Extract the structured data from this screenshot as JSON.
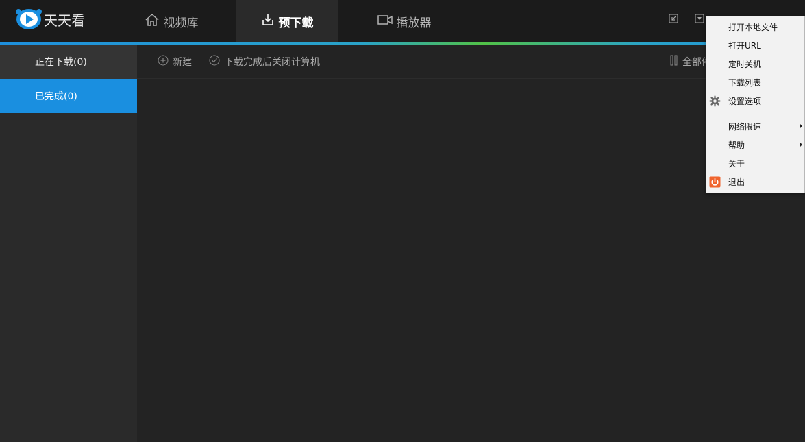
{
  "app": {
    "name": "天天看",
    "brand_color": "#1a8fe0"
  },
  "nav": {
    "tabs": [
      {
        "label": "视频库",
        "icon": "home-icon",
        "active": false
      },
      {
        "label": "预下载",
        "icon": "download-icon",
        "active": true
      },
      {
        "label": "播放器",
        "icon": "video-camera-icon",
        "active": false
      }
    ]
  },
  "window_controls": {
    "mini_icon": "mini-mode-icon",
    "menu_icon": "dropdown-menu-icon"
  },
  "sidebar": {
    "items": [
      {
        "label": "正在下载(0)",
        "active": false
      },
      {
        "label": "已完成(0)",
        "active": true
      }
    ]
  },
  "toolbar": {
    "new_label": "新建",
    "shutdown_label": "下载完成后关闭计算机",
    "pause_all_label": "全部停"
  },
  "context_menu": {
    "items": [
      {
        "label": "打开本地文件"
      },
      {
        "label": "打开URL"
      },
      {
        "label": "定时关机"
      },
      {
        "label": "下载列表"
      },
      {
        "label": "设置选项",
        "icon": "gear-icon"
      },
      {
        "label": "网络限速",
        "submenu": true
      },
      {
        "label": "帮助",
        "submenu": true
      },
      {
        "label": "关于"
      },
      {
        "label": "退出",
        "icon": "power-icon"
      }
    ]
  },
  "colors": {
    "header_bg": "#1b1b1b",
    "sidebar_active": "#1a8fe0",
    "exit_icon": "#f0642d"
  }
}
